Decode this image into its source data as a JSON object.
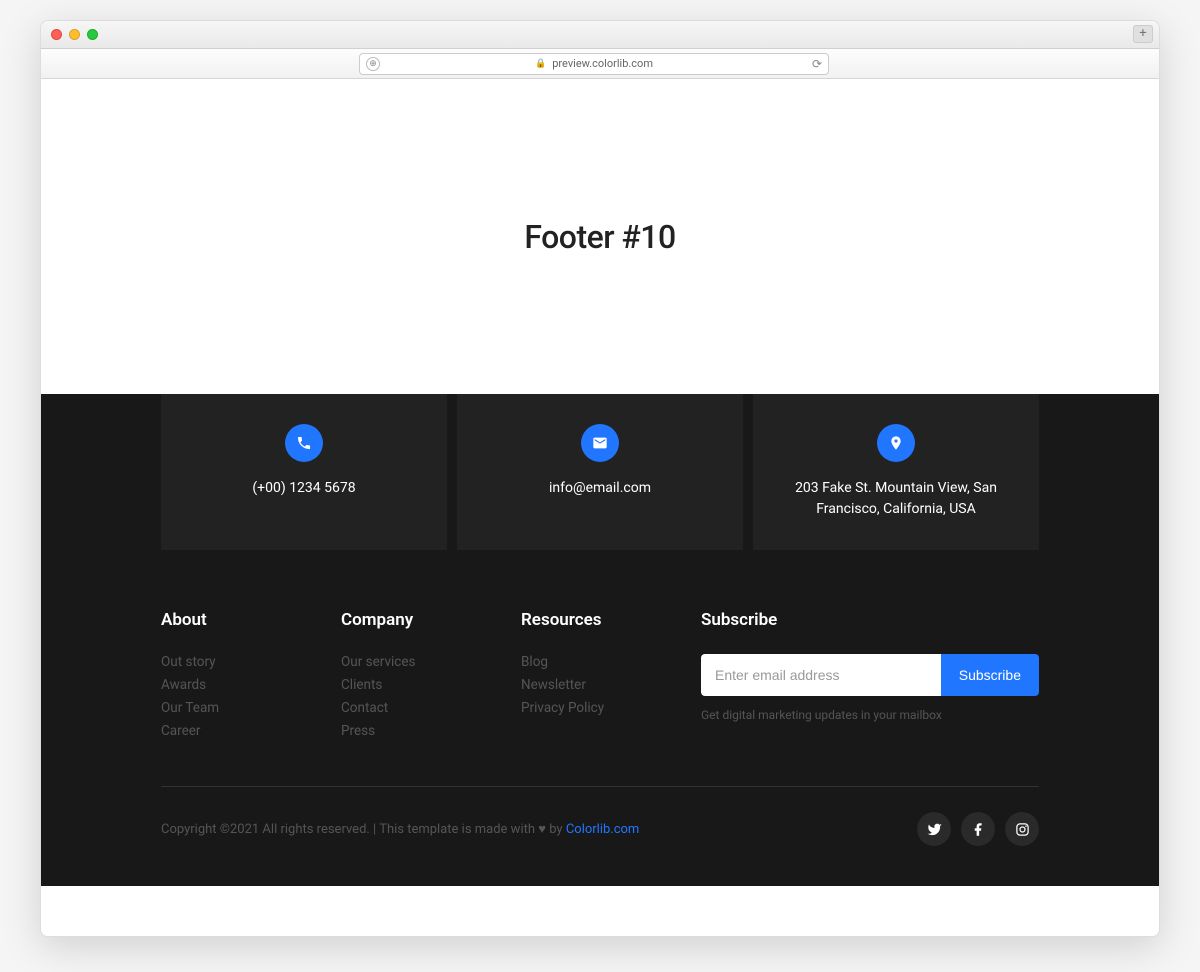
{
  "browser": {
    "url": "preview.colorlib.com"
  },
  "hero": {
    "title": "Footer #10"
  },
  "contacts": {
    "phone": "(+00) 1234 5678",
    "email": "info@email.com",
    "address": "203 Fake St. Mountain View, San Francisco, California, USA"
  },
  "columns": {
    "about": {
      "heading": "About",
      "links": [
        "Out story",
        "Awards",
        "Our Team",
        "Career"
      ]
    },
    "company": {
      "heading": "Company",
      "links": [
        "Our services",
        "Clients",
        "Contact",
        "Press"
      ]
    },
    "resources": {
      "heading": "Resources",
      "links": [
        "Blog",
        "Newsletter",
        "Privacy Policy"
      ]
    }
  },
  "subscribe": {
    "heading": "Subscribe",
    "placeholder": "Enter email address",
    "button": "Subscribe",
    "note": "Get digital marketing updates in your mailbox"
  },
  "bottom": {
    "copyright_prefix": "Copyright ©2021 All rights reserved. | This template is made with ",
    "copyright_by": " by ",
    "link_text": "Colorlib.com"
  }
}
